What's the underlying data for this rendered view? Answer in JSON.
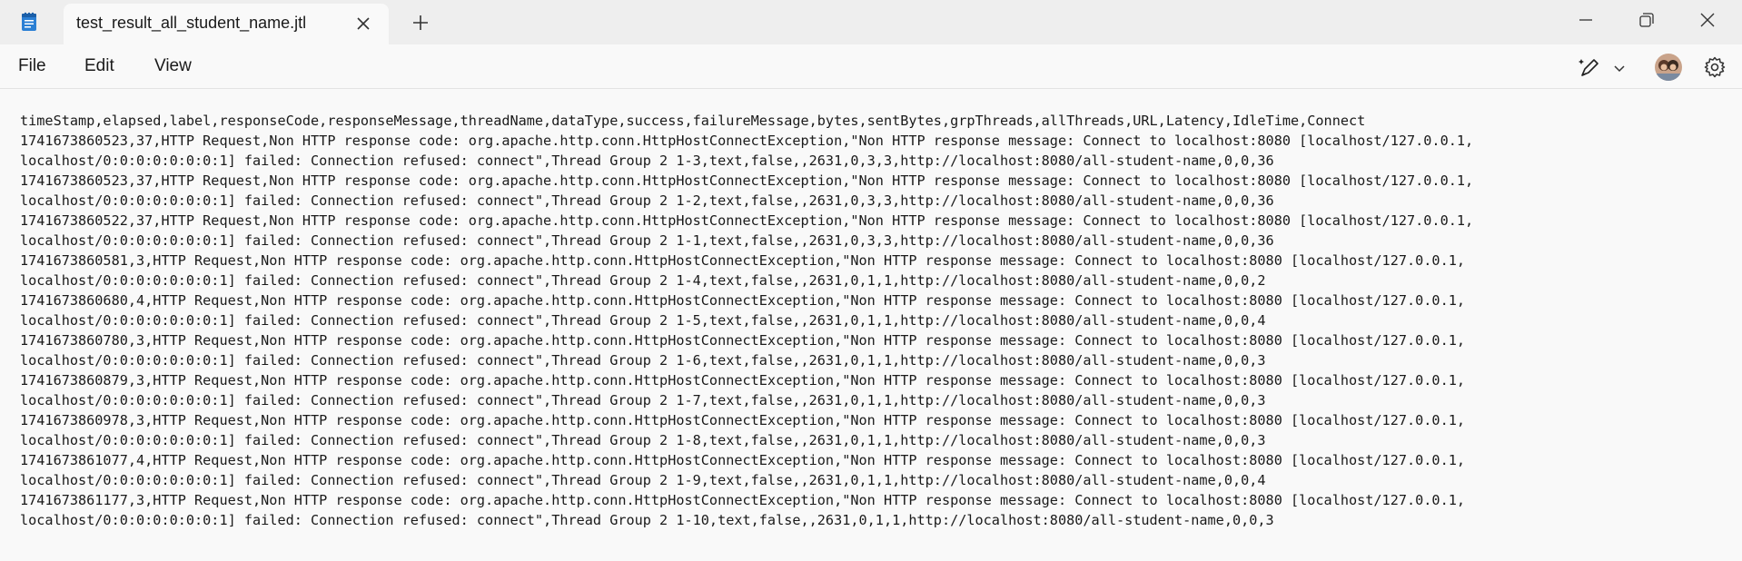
{
  "tab": {
    "title": "test_result_all_student_name.jtl"
  },
  "menu": {
    "file": "File",
    "edit": "Edit",
    "view": "View"
  },
  "icons": {
    "app": "notepad-icon",
    "close_tab": "close-icon",
    "new_tab": "plus-icon",
    "minimize": "minimize-icon",
    "restore": "restore-icon",
    "close_window": "close-icon",
    "copilot": "copilot-pen-icon",
    "dropdown": "chevron-down-icon",
    "settings": "gear-icon"
  },
  "colors": {
    "titlebar": "#eeeeee",
    "editor_bg": "#f9f9f9",
    "text": "#1a1a1a",
    "app_icon": "#2b7fd4"
  },
  "document": {
    "lines": [
      "timeStamp,elapsed,label,responseCode,responseMessage,threadName,dataType,success,failureMessage,bytes,sentBytes,grpThreads,allThreads,URL,Latency,IdleTime,Connect",
      "1741673860523,37,HTTP Request,Non HTTP response code: org.apache.http.conn.HttpHostConnectException,\"Non HTTP response message: Connect to localhost:8080 [localhost/127.0.0.1,",
      "localhost/0:0:0:0:0:0:0:1] failed: Connection refused: connect\",Thread Group 2 1-3,text,false,,2631,0,3,3,http://localhost:8080/all-student-name,0,0,36",
      "1741673860523,37,HTTP Request,Non HTTP response code: org.apache.http.conn.HttpHostConnectException,\"Non HTTP response message: Connect to localhost:8080 [localhost/127.0.0.1,",
      "localhost/0:0:0:0:0:0:0:1] failed: Connection refused: connect\",Thread Group 2 1-2,text,false,,2631,0,3,3,http://localhost:8080/all-student-name,0,0,36",
      "1741673860522,37,HTTP Request,Non HTTP response code: org.apache.http.conn.HttpHostConnectException,\"Non HTTP response message: Connect to localhost:8080 [localhost/127.0.0.1,",
      "localhost/0:0:0:0:0:0:0:1] failed: Connection refused: connect\",Thread Group 2 1-1,text,false,,2631,0,3,3,http://localhost:8080/all-student-name,0,0,36",
      "1741673860581,3,HTTP Request,Non HTTP response code: org.apache.http.conn.HttpHostConnectException,\"Non HTTP response message: Connect to localhost:8080 [localhost/127.0.0.1,",
      "localhost/0:0:0:0:0:0:0:1] failed: Connection refused: connect\",Thread Group 2 1-4,text,false,,2631,0,1,1,http://localhost:8080/all-student-name,0,0,2",
      "1741673860680,4,HTTP Request,Non HTTP response code: org.apache.http.conn.HttpHostConnectException,\"Non HTTP response message: Connect to localhost:8080 [localhost/127.0.0.1,",
      "localhost/0:0:0:0:0:0:0:1] failed: Connection refused: connect\",Thread Group 2 1-5,text,false,,2631,0,1,1,http://localhost:8080/all-student-name,0,0,4",
      "1741673860780,3,HTTP Request,Non HTTP response code: org.apache.http.conn.HttpHostConnectException,\"Non HTTP response message: Connect to localhost:8080 [localhost/127.0.0.1,",
      "localhost/0:0:0:0:0:0:0:1] failed: Connection refused: connect\",Thread Group 2 1-6,text,false,,2631,0,1,1,http://localhost:8080/all-student-name,0,0,3",
      "1741673860879,3,HTTP Request,Non HTTP response code: org.apache.http.conn.HttpHostConnectException,\"Non HTTP response message: Connect to localhost:8080 [localhost/127.0.0.1,",
      "localhost/0:0:0:0:0:0:0:1] failed: Connection refused: connect\",Thread Group 2 1-7,text,false,,2631,0,1,1,http://localhost:8080/all-student-name,0,0,3",
      "1741673860978,3,HTTP Request,Non HTTP response code: org.apache.http.conn.HttpHostConnectException,\"Non HTTP response message: Connect to localhost:8080 [localhost/127.0.0.1,",
      "localhost/0:0:0:0:0:0:0:1] failed: Connection refused: connect\",Thread Group 2 1-8,text,false,,2631,0,1,1,http://localhost:8080/all-student-name,0,0,3",
      "1741673861077,4,HTTP Request,Non HTTP response code: org.apache.http.conn.HttpHostConnectException,\"Non HTTP response message: Connect to localhost:8080 [localhost/127.0.0.1,",
      "localhost/0:0:0:0:0:0:0:1] failed: Connection refused: connect\",Thread Group 2 1-9,text,false,,2631,0,1,1,http://localhost:8080/all-student-name,0,0,4",
      "1741673861177,3,HTTP Request,Non HTTP response code: org.apache.http.conn.HttpHostConnectException,\"Non HTTP response message: Connect to localhost:8080 [localhost/127.0.0.1,",
      "localhost/0:0:0:0:0:0:0:1] failed: Connection refused: connect\",Thread Group 2 1-10,text,false,,2631,0,1,1,http://localhost:8080/all-student-name,0,0,3"
    ]
  }
}
